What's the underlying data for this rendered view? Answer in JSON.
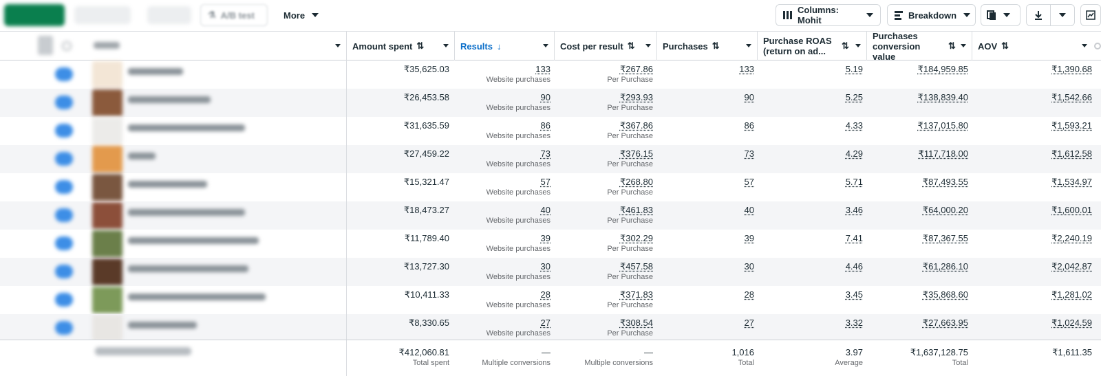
{
  "toolbar": {
    "blurred_left": [
      "create",
      "duplicate",
      "edit"
    ],
    "ab_test_label": "A/B test",
    "more_label": "More",
    "columns_label": "Columns: Mohit",
    "breakdown_label": "Breakdown"
  },
  "columns": [
    {
      "key": "amount_spent",
      "label": "Amount spent",
      "sort": "⇅"
    },
    {
      "key": "results",
      "label": "Results",
      "sort": "↓",
      "active": true
    },
    {
      "key": "cost_per_result",
      "label": "Cost per result",
      "sort": "⇅"
    },
    {
      "key": "purchases",
      "label": "Purchases",
      "sort": "⇅"
    },
    {
      "key": "roas",
      "label": "Purchase ROAS (return on ad...",
      "sort": "⇅"
    },
    {
      "key": "conv_value",
      "label": "Purchases conversion value",
      "sort": "⇅"
    },
    {
      "key": "aov",
      "label": "AOV",
      "sort": "⇅"
    }
  ],
  "rows": [
    {
      "amount_spent": "₹35,625.03",
      "results": "133",
      "results_sub": "Website purchases",
      "cost_per_result": "₹267.86",
      "cpr_sub": "Per Purchase",
      "purchases": "133",
      "roas": "5.19",
      "conv_value": "₹184,959.85",
      "aov": "₹1,390.68"
    },
    {
      "amount_spent": "₹26,453.58",
      "results": "90",
      "results_sub": "Website purchases",
      "cost_per_result": "₹293.93",
      "cpr_sub": "Per Purchase",
      "purchases": "90",
      "roas": "5.25",
      "conv_value": "₹138,839.40",
      "aov": "₹1,542.66"
    },
    {
      "amount_spent": "₹31,635.59",
      "results": "86",
      "results_sub": "Website purchases",
      "cost_per_result": "₹367.86",
      "cpr_sub": "Per Purchase",
      "purchases": "86",
      "roas": "4.33",
      "conv_value": "₹137,015.80",
      "aov": "₹1,593.21"
    },
    {
      "amount_spent": "₹27,459.22",
      "results": "73",
      "results_sub": "Website purchases",
      "cost_per_result": "₹376.15",
      "cpr_sub": "Per Purchase",
      "purchases": "73",
      "roas": "4.29",
      "conv_value": "₹117,718.00",
      "aov": "₹1,612.58"
    },
    {
      "amount_spent": "₹15,321.47",
      "results": "57",
      "results_sub": "Website purchases",
      "cost_per_result": "₹268.80",
      "cpr_sub": "Per Purchase",
      "purchases": "57",
      "roas": "5.71",
      "conv_value": "₹87,493.55",
      "aov": "₹1,534.97"
    },
    {
      "amount_spent": "₹18,473.27",
      "results": "40",
      "results_sub": "Website purchases",
      "cost_per_result": "₹461.83",
      "cpr_sub": "Per Purchase",
      "purchases": "40",
      "roas": "3.46",
      "conv_value": "₹64,000.20",
      "aov": "₹1,600.01"
    },
    {
      "amount_spent": "₹11,789.40",
      "results": "39",
      "results_sub": "Website purchases",
      "cost_per_result": "₹302.29",
      "cpr_sub": "Per Purchase",
      "purchases": "39",
      "roas": "7.41",
      "conv_value": "₹87,367.55",
      "aov": "₹2,240.19"
    },
    {
      "amount_spent": "₹13,727.30",
      "results": "30",
      "results_sub": "Website purchases",
      "cost_per_result": "₹457.58",
      "cpr_sub": "Per Purchase",
      "purchases": "30",
      "roas": "4.46",
      "conv_value": "₹61,286.10",
      "aov": "₹2,042.87"
    },
    {
      "amount_spent": "₹10,411.33",
      "results": "28",
      "results_sub": "Website purchases",
      "cost_per_result": "₹371.83",
      "cpr_sub": "Per Purchase",
      "purchases": "28",
      "roas": "3.45",
      "conv_value": "₹35,868.60",
      "aov": "₹1,281.02"
    },
    {
      "amount_spent": "₹8,330.65",
      "results": "27",
      "results_sub": "Website purchases",
      "cost_per_result": "₹308.54",
      "cpr_sub": "Per Purchase",
      "purchases": "27",
      "roas": "3.32",
      "conv_value": "₹27,663.95",
      "aov": "₹1,024.59"
    }
  ],
  "totals": {
    "amount_spent": "₹412,060.81",
    "amount_spent_sub": "Total spent",
    "results": "—",
    "results_sub": "Multiple conversions",
    "cost_per_result": "—",
    "cpr_sub": "Multiple conversions",
    "purchases": "1,016",
    "purchases_sub": "Total",
    "roas": "3.97",
    "roas_sub": "Average",
    "conv_value": "₹1,637,128.75",
    "conv_value_sub": "Total",
    "aov": "₹1,611.35"
  },
  "colors": {
    "accent": "#0a6ec9",
    "create": "#0a7f4e",
    "toggle": "#3d8ee6"
  },
  "thumb_colors": [
    "#f3e6d6",
    "#8b5a3c",
    "#ecebe9",
    "#e39a4d",
    "#7a5740",
    "#8c4f3a",
    "#6b7f4a",
    "#5a3a28",
    "#7d9a5a",
    "#e8e6e3"
  ]
}
